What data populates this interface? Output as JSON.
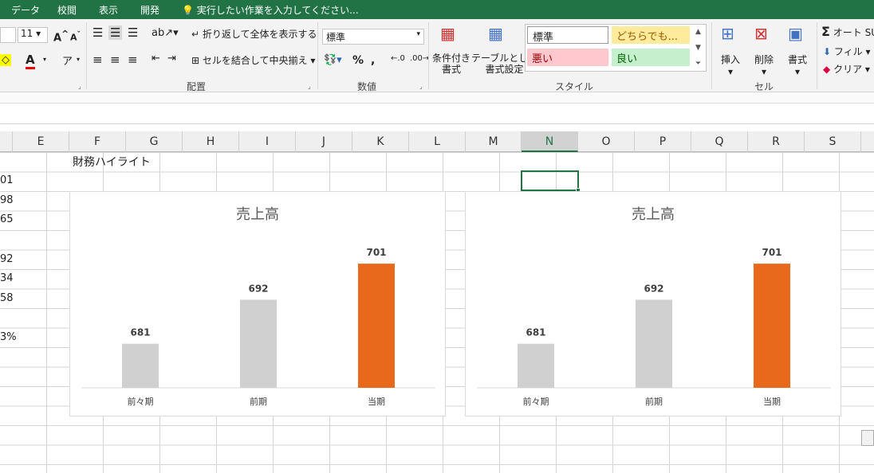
{
  "menu": {
    "tabs": [
      "データ",
      "校閲",
      "表示",
      "開発"
    ],
    "tell_me": "実行したい作業を入力してください..."
  },
  "ribbon": {
    "font_size": "11",
    "wrap_text": "折り返して全体を表示する",
    "merge_center": "セルを結合して中央揃え",
    "alignment_label": "配置",
    "number_format": "標準",
    "number_label": "数値",
    "conditional_format": "条件付き\n書式",
    "format_as_table": "テーブルとして\n書式設定",
    "styles_label": "スタイル",
    "styles": {
      "normal": "標準",
      "neutral": "どちらでも...",
      "bad": "悪い",
      "good": "良い"
    },
    "insert": "挿入",
    "delete": "削除",
    "format": "書式",
    "cells_label": "セル",
    "autosum": "オート SU",
    "fill": "フィル",
    "clear": "クリア",
    "colors": {
      "bad_bg": "#ffc7ce",
      "neutral_bg": "#ffeb9c",
      "good_bg": "#c6efce",
      "excel_green": "#217346"
    }
  },
  "sheet": {
    "columns": [
      "E",
      "F",
      "G",
      "H",
      "I",
      "J",
      "K",
      "L",
      "M",
      "N",
      "O",
      "P",
      "Q",
      "R",
      "S"
    ],
    "selected_column": "N",
    "row_values": [
      "01",
      "98",
      "65",
      "",
      "92",
      "34",
      "58",
      "",
      "3%"
    ],
    "cell_f1": "財務ハイライト"
  },
  "chart_data": [
    {
      "type": "bar",
      "title": "売上高",
      "categories": [
        "前々期",
        "前期",
        "当期"
      ],
      "values": [
        681,
        692,
        701
      ],
      "colors": [
        "#d0d0d0",
        "#d0d0d0",
        "#e8691c"
      ],
      "ylim": [
        670,
        705
      ],
      "grid": false,
      "legend": "none"
    },
    {
      "type": "bar",
      "title": "売上高",
      "categories": [
        "前々期",
        "前期",
        "当期"
      ],
      "values": [
        681,
        692,
        701
      ],
      "colors": [
        "#d0d0d0",
        "#d0d0d0",
        "#e8691c"
      ],
      "ylim": [
        670,
        705
      ],
      "grid": false,
      "legend": "none"
    }
  ]
}
